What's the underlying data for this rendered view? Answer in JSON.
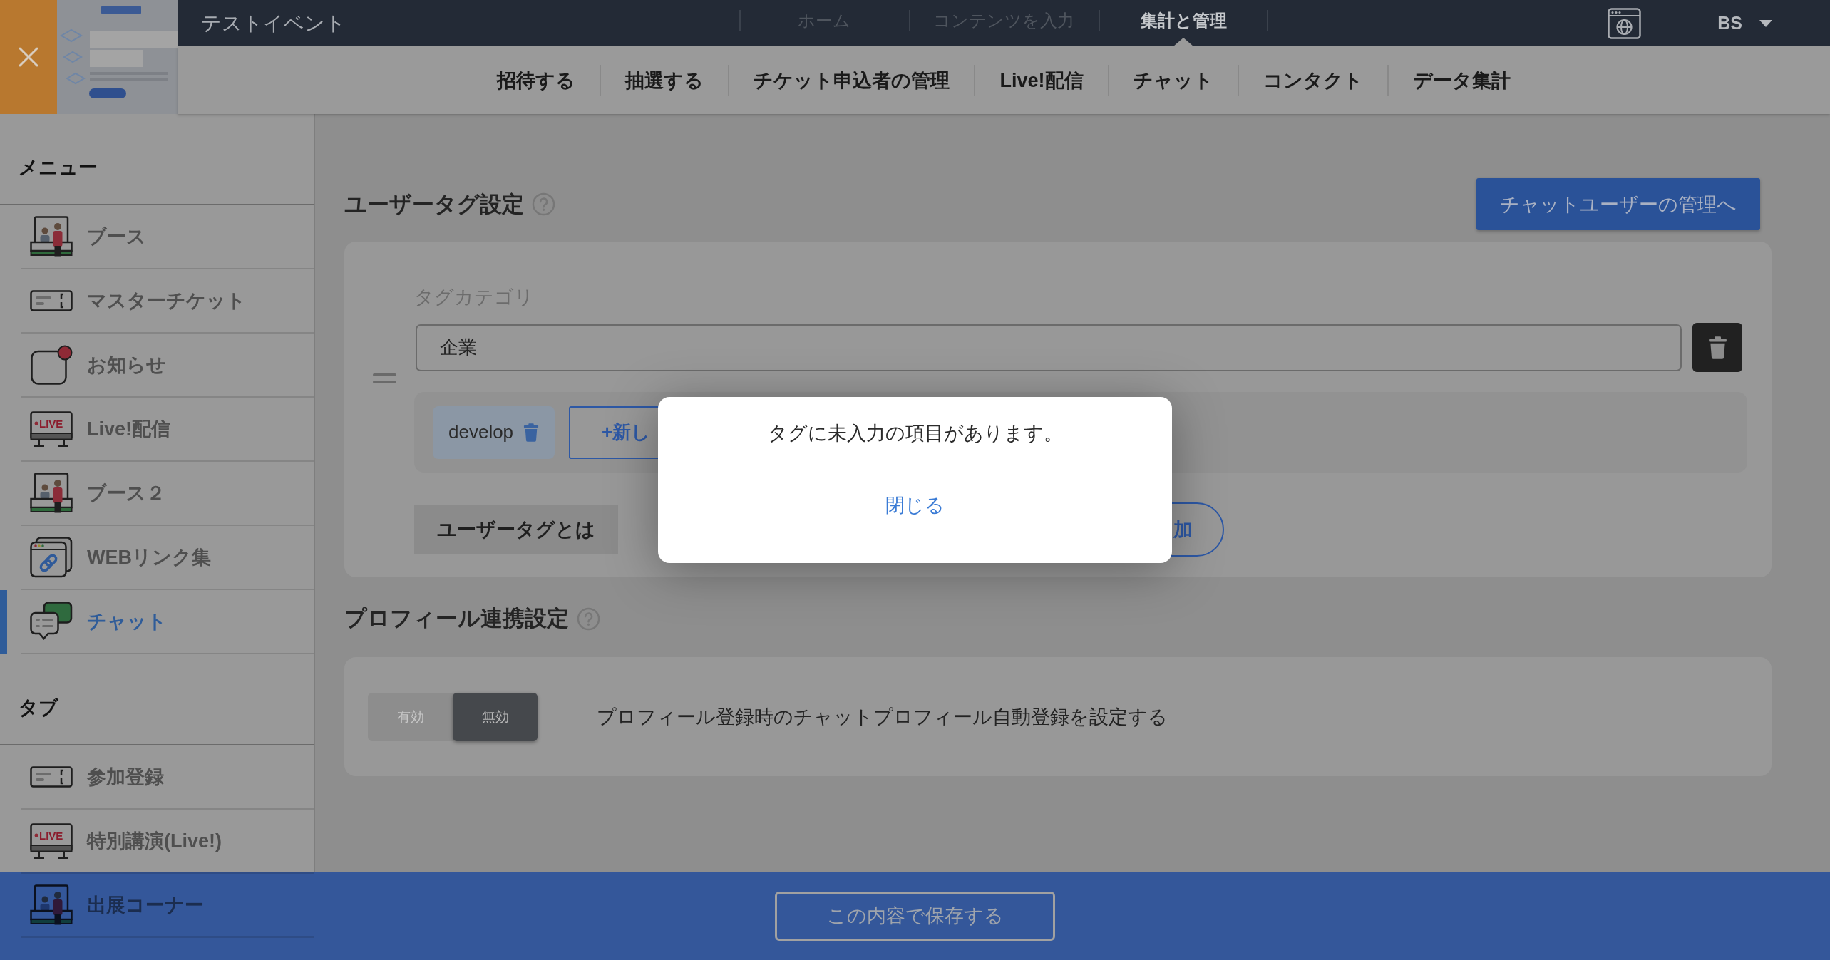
{
  "header": {
    "event_title": "テストイベント",
    "top_nav": [
      {
        "label": "ホーム",
        "selected": false
      },
      {
        "label": "コンテンツを入力",
        "selected": false
      },
      {
        "label": "集計と管理",
        "selected": true
      }
    ],
    "account": "BS"
  },
  "sub_nav": [
    "招待する",
    "抽選する",
    "チケット申込者の管理",
    "Live!配信",
    "チャット",
    "コンタクト",
    "データ集計"
  ],
  "sidebar": {
    "sections": [
      {
        "title": "メニュー",
        "items": [
          {
            "label": "ブース",
            "kind": "booth",
            "selected": false
          },
          {
            "label": "マスターチケット",
            "kind": "ticket",
            "selected": false
          },
          {
            "label": "お知らせ",
            "kind": "notice",
            "selected": false
          },
          {
            "label": "Live!配信",
            "kind": "live",
            "icon_text": "LIVE",
            "selected": false
          },
          {
            "label": "ブース２",
            "kind": "booth",
            "selected": false
          },
          {
            "label": "WEBリンク集",
            "kind": "link",
            "selected": false
          },
          {
            "label": "チャット",
            "kind": "chat",
            "selected": true
          }
        ]
      },
      {
        "title": "タブ",
        "items": [
          {
            "label": "参加登録",
            "kind": "ticket",
            "selected": false
          },
          {
            "label": "特別講演(Live!)",
            "kind": "live",
            "icon_text": "LIVE",
            "selected": false
          },
          {
            "label": "出展コーナー",
            "kind": "booth",
            "selected": false
          }
        ]
      }
    ]
  },
  "user_tags": {
    "title": "ユーザータグ設定",
    "manage_button": "チャットユーザーの管理へ",
    "categories": [
      {
        "label": "タグカテゴリ",
        "value": "企業",
        "tags": [
          "develop"
        ],
        "new_tag_button": "+新し"
      }
    ],
    "about_button": "ユーザータグとは",
    "add_button": "加"
  },
  "profile_link": {
    "title": "プロフィール連携設定",
    "options": [
      {
        "label": "有効",
        "selected": false
      },
      {
        "label": "無効",
        "selected": true
      }
    ],
    "description": "プロフィール登録時のチャットプロフィール自動登録を設定する"
  },
  "footer": {
    "save_button": "この内容で保存する"
  },
  "dialog": {
    "message": "タグに未入力の項目があります。",
    "close_button": "閉じる"
  }
}
